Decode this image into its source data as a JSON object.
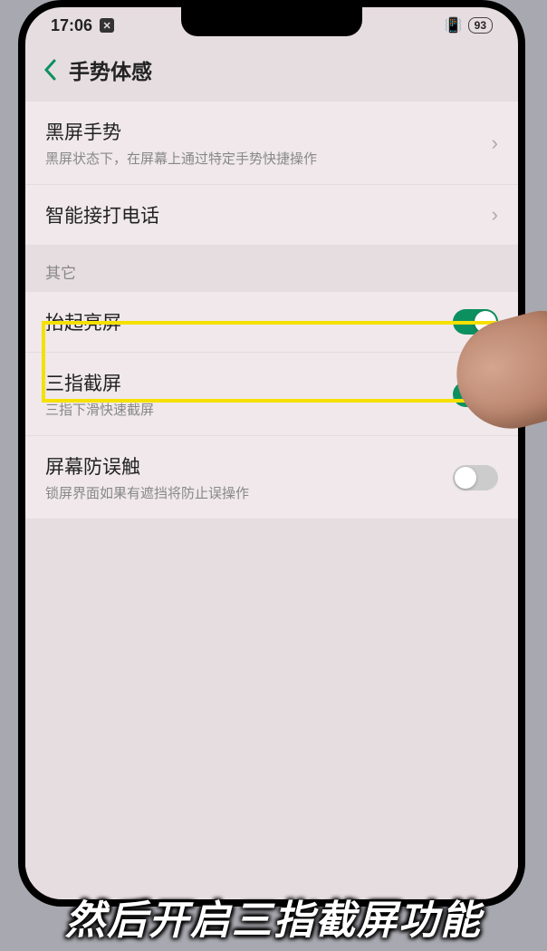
{
  "statusBar": {
    "time": "17:06",
    "battery": "93"
  },
  "header": {
    "title": "手势体感"
  },
  "items": {
    "blackScreen": {
      "title": "黑屏手势",
      "sub": "黑屏状态下，在屏幕上通过特定手势快捷操作"
    },
    "smartCall": {
      "title": "智能接打电话"
    },
    "otherLabel": "其它",
    "raiseToWake": {
      "title": "抬起亮屏"
    },
    "threeFinger": {
      "title": "三指截屏",
      "sub": "三指下滑快速截屏"
    },
    "antiTouch": {
      "title": "屏幕防误触",
      "sub": "锁屏界面如果有遮挡将防止误操作"
    }
  },
  "caption": "然后开启三指截屏功能"
}
